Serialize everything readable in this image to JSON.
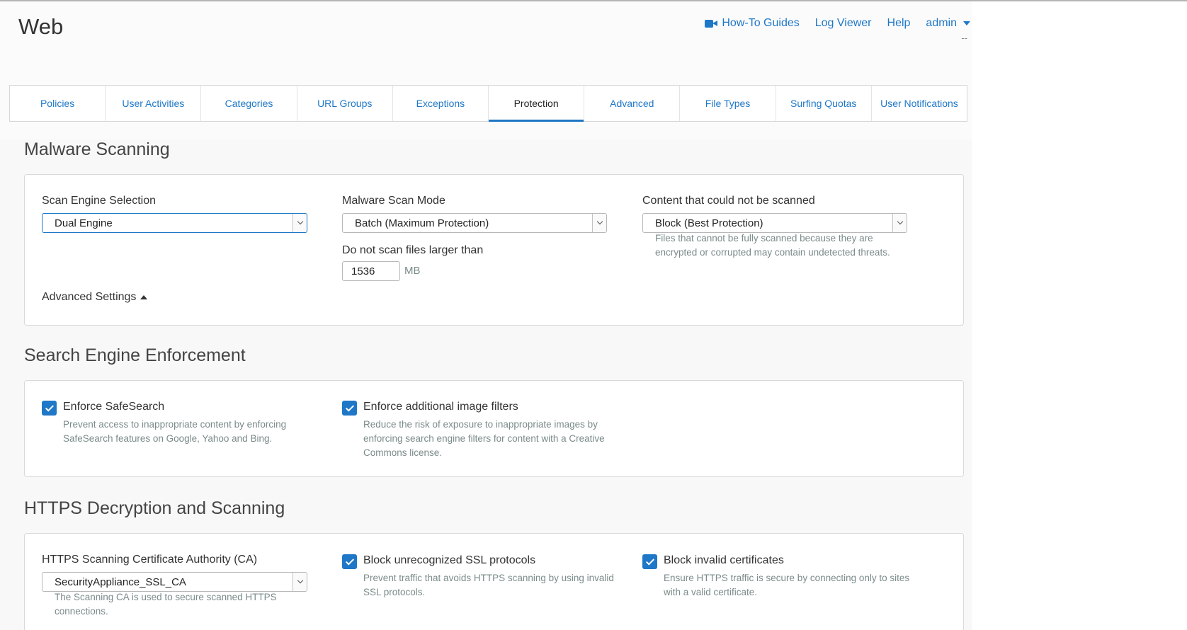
{
  "page": {
    "title": "Web"
  },
  "top_links": {
    "guides": "How-To Guides",
    "log_viewer": "Log Viewer",
    "help": "Help",
    "admin": "admin",
    "sub": "--"
  },
  "tabs": [
    {
      "label": "Policies",
      "active": false
    },
    {
      "label": "User Activities",
      "active": false
    },
    {
      "label": "Categories",
      "active": false
    },
    {
      "label": "URL Groups",
      "active": false
    },
    {
      "label": "Exceptions",
      "active": false
    },
    {
      "label": "Protection",
      "active": true
    },
    {
      "label": "Advanced",
      "active": false
    },
    {
      "label": "File Types",
      "active": false
    },
    {
      "label": "Surfing Quotas",
      "active": false
    },
    {
      "label": "User Notifications",
      "active": false
    }
  ],
  "malware": {
    "title": "Malware Scanning",
    "engine_label": "Scan Engine Selection",
    "engine_value": "Dual Engine",
    "mode_label": "Malware Scan Mode",
    "mode_value": "Batch (Maximum Protection)",
    "size_label": "Do not scan files larger than",
    "size_value": "1536",
    "size_unit": "MB",
    "unscanned_label": "Content that could not be scanned",
    "unscanned_value": "Block (Best Protection)",
    "unscanned_help_1": "Files that cannot be fully scanned because they are",
    "unscanned_help_2": "encrypted or corrupted may contain undetected threats.",
    "advanced": "Advanced Settings"
  },
  "search": {
    "title": "Search Engine Enforcement",
    "safesearch_label": "Enforce SafeSearch",
    "safesearch_checked": true,
    "safesearch_help_1": "Prevent access to inappropriate content by enforcing",
    "safesearch_help_2": "SafeSearch features on Google, Yahoo and Bing.",
    "image_label": "Enforce additional image filters",
    "image_checked": true,
    "image_help_1": "Reduce the risk of exposure to inappropriate images by",
    "image_help_2": "enforcing search engine filters for content with a Creative",
    "image_help_3": "Commons license."
  },
  "https": {
    "title": "HTTPS Decryption and Scanning",
    "ca_label": "HTTPS Scanning Certificate Authority (CA)",
    "ca_value": "SecurityAppliance_SSL_CA",
    "ca_help_1": "The Scanning CA is used to secure scanned HTTPS",
    "ca_help_2": "connections.",
    "ssl_label": "Block unrecognized SSL protocols",
    "ssl_checked": true,
    "ssl_help_1": "Prevent traffic that avoids HTTPS scanning by using invalid",
    "ssl_help_2": "SSL protocols.",
    "cert_label": "Block invalid certificates",
    "cert_checked": true,
    "cert_help_1": "Ensure HTTPS traffic is secure by connecting only to sites",
    "cert_help_2": "with a valid certificate."
  },
  "colors": {
    "accent": "#1e77c7",
    "help_text": "#7b8a8a",
    "page_bg": "#f8f8f8"
  }
}
